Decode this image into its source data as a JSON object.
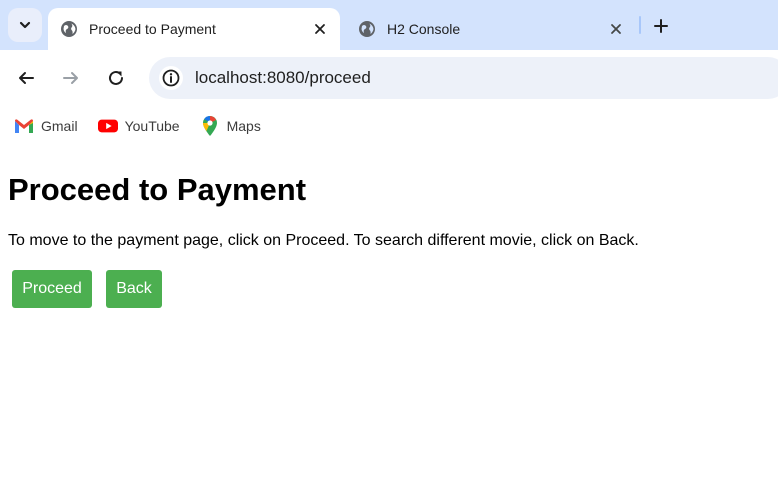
{
  "browser": {
    "tabs": [
      {
        "title": "Proceed to Payment",
        "active": true,
        "icon": "globe-icon"
      },
      {
        "title": "H2 Console",
        "active": false,
        "icon": "globe-icon"
      }
    ],
    "address_bar": {
      "url": "localhost:8080/proceed"
    },
    "bookmarks": [
      {
        "label": "Gmail",
        "icon": "gmail-icon"
      },
      {
        "label": "YouTube",
        "icon": "youtube-icon"
      },
      {
        "label": "Maps",
        "icon": "maps-icon"
      }
    ]
  },
  "page": {
    "heading": "Proceed to Payment",
    "instructions": "To move to the payment page, click on Proceed. To search different movie, click on Back.",
    "buttons": {
      "proceed_label": "Proceed",
      "back_label": "Back"
    },
    "button_color": "#4caf50"
  },
  "colors": {
    "tabstrip": "#d3e3fd",
    "omnibox": "#edf1f9"
  }
}
